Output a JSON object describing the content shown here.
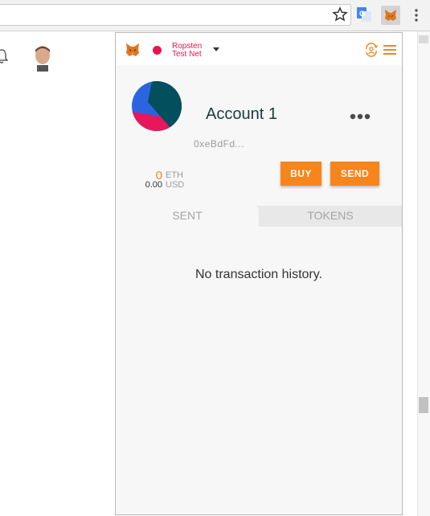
{
  "network": {
    "name": "Ropsten Test Net",
    "line1": "Ropsten",
    "line2": "Test Net",
    "color": "#e91550"
  },
  "account": {
    "name": "Account 1",
    "address": "0xeBdFd...",
    "eth_balance": "0",
    "eth_unit": "ETH",
    "usd_balance": "0.00",
    "usd_unit": "USD"
  },
  "actions": {
    "buy_label": "BUY",
    "send_label": "SEND"
  },
  "tabs": [
    {
      "label": "SENT",
      "active": true
    },
    {
      "label": "TOKENS",
      "active": false
    }
  ],
  "transactions": {
    "empty_message": "No transaction history."
  },
  "icons": {
    "fox": "metamask-fox-icon",
    "star": "star-icon",
    "translate": "google-translate-icon",
    "menu": "hamburger-icon",
    "account_switch": "account-switch-icon",
    "more": "more-options-icon"
  },
  "colors": {
    "accent": "#f6851b",
    "account_name": "#1b3b38"
  }
}
